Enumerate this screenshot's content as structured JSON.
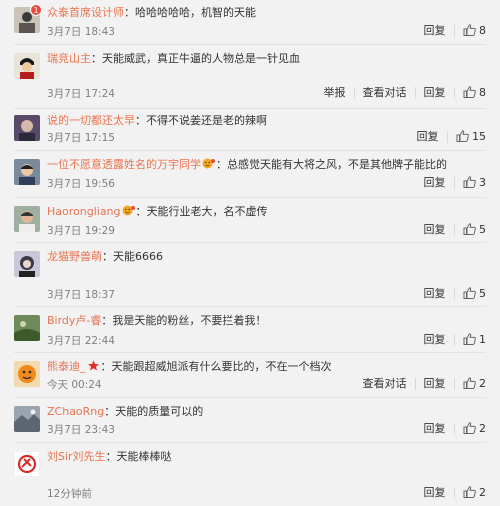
{
  "comments": [
    {
      "user": "众泰首席设计师",
      "badge": "1",
      "text": "：哈哈哈哈哈，机智的天能",
      "time": "3月7日 18:43",
      "actions": [],
      "reply": "回复",
      "likes": "8"
    },
    {
      "user": "瑞竞山主",
      "text": "：天能威武，真正牛逼的人物总是一针见血",
      "time": "3月7日 17:24",
      "actions": [
        "举报",
        "查看对话"
      ],
      "reply": "回复",
      "likes": "8"
    },
    {
      "user": "说的一切都还太早",
      "text": "：不得不说姜还是老的辣啊",
      "time": "3月7日 17:15",
      "actions": [],
      "reply": "回复",
      "likes": "15"
    },
    {
      "user": "一位不愿意透露姓名的万宇同学",
      "text": "：总感觉天能有大将之风，不是其他牌子能比的",
      "time": "3月7日 19:56",
      "actions": [],
      "reply": "回复",
      "likes": "3"
    },
    {
      "user": "Haorongliang",
      "text": "：天能行业老大，名不虚传",
      "time": "3月7日 19:29",
      "actions": [],
      "reply": "回复",
      "likes": "5"
    },
    {
      "user": "龙猫野兽萌",
      "text": "：天能6666",
      "time": "3月7日 18:37",
      "actions": [],
      "reply": "回复",
      "likes": "5"
    },
    {
      "user": "Birdy卢-睿",
      "text": "：我是天能的粉丝，不要拦着我！",
      "time": "3月7日 22:44",
      "actions": [],
      "reply": "回复",
      "likes": "1"
    },
    {
      "user": "熊泰迪_",
      "text": "：天能跟超威旭派有什么要比的，不在一个档次",
      "time": "今天 00:24",
      "actions": [
        "查看对话"
      ],
      "reply": "回复",
      "likes": "2"
    },
    {
      "user": "ZChaoRng",
      "text": "：天能的质量可以的",
      "time": "3月7日 23:43",
      "actions": [],
      "reply": "回复",
      "likes": "2"
    },
    {
      "user": "刘Sir刘先生",
      "text": "：天能棒棒哒",
      "time": "12分钟前",
      "actions": [],
      "reply": "回复",
      "likes": "2"
    }
  ],
  "colors": {
    "username": "#eb7350",
    "background": "#f2f2f2",
    "text": "#333333",
    "time": "#808080"
  }
}
